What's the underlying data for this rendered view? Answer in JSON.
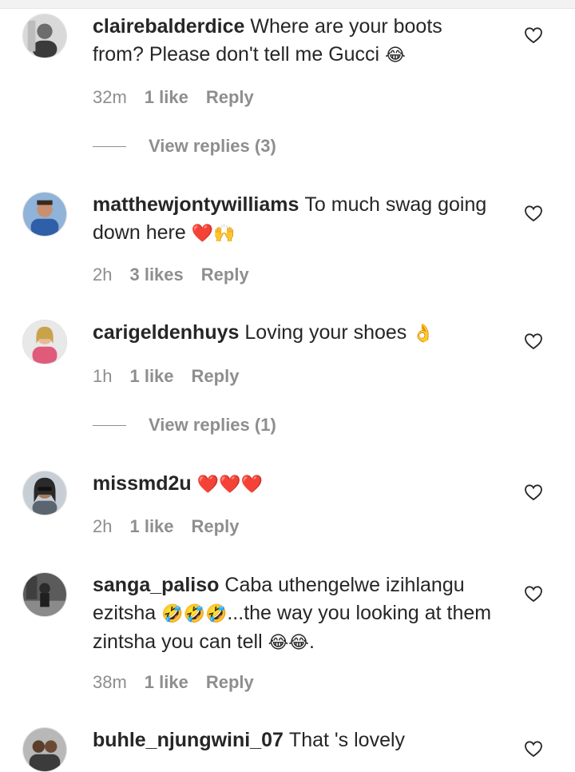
{
  "comments": [
    {
      "username": "clairebalderdice",
      "text": "Where are your boots from? Please don't tell me Gucci",
      "emoji": "😂",
      "time": "32m",
      "likes": "1 like",
      "reply": "Reply",
      "view_replies": "View replies (3)",
      "avatar_color": "#cfcfcf"
    },
    {
      "username": "matthewjontywilliams",
      "text": "To much swag going down here",
      "emoji": "❤️🙌",
      "time": "2h",
      "likes": "3 likes",
      "reply": "Reply",
      "avatar_color": "#2f5fa8"
    },
    {
      "username": "carigeldenhuys",
      "text": "Loving your shoes",
      "emoji": "👌",
      "time": "1h",
      "likes": "1 like",
      "reply": "Reply",
      "view_replies": "View replies (1)",
      "avatar_color": "#e05a7a"
    },
    {
      "username": "missmd2u",
      "text": "",
      "emoji": "❤️❤️❤️",
      "time": "2h",
      "likes": "1 like",
      "reply": "Reply",
      "avatar_color": "#9aa3ad"
    },
    {
      "username": "sanga_paliso",
      "text": "Caba uthengelwe izihlangu ezitsha",
      "emoji": "🤣🤣🤣",
      "text2": "...the way you looking at them zintsha you can tell",
      "emoji2": "😂😂",
      "text3": ".",
      "time": "38m",
      "likes": "1 like",
      "reply": "Reply",
      "avatar_color": "#4a4a4a"
    },
    {
      "username": "buhle_njungwini_07",
      "text": "That 's lovely",
      "avatar_color": "#7a7a7a"
    }
  ],
  "colors": {
    "text": "#262626",
    "meta": "#8e8e8e",
    "heart_emoji": "#e8203a"
  },
  "icons": {
    "like": "heart-outline-icon"
  }
}
